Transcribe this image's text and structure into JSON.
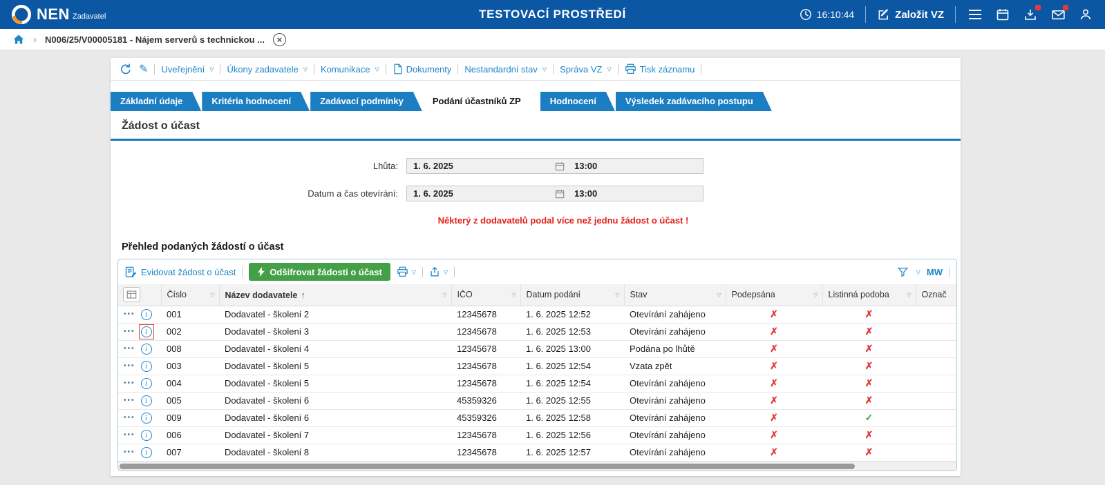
{
  "colors": {
    "topbar_bg": "#0b57a4",
    "tab_blue": "#1b7ec2",
    "link_blue": "#1d86c8",
    "green_button": "#43a047",
    "warning_red": "#e32119",
    "x_red": "#e53935",
    "check_green": "#43a047",
    "logo_orange": "#f7941d"
  },
  "topbar": {
    "brand": "NEN",
    "brand_sub": "Zadavatel",
    "env_title": "TESTOVACÍ PROSTŘEDÍ",
    "time": "16:10:44",
    "create_vz_label": "Založit VZ"
  },
  "breadcrumb": {
    "item": "N006/25/V00005181 - Nájem serverů s technickou ...",
    "separator": "›"
  },
  "toolbar": {
    "items": [
      {
        "label": "Uveřejnění",
        "caret": true
      },
      {
        "label": "Úkony zadavatele",
        "caret": true
      },
      {
        "label": "Komunikace",
        "caret": true
      },
      {
        "label": "Dokumenty",
        "icon": "document"
      },
      {
        "label": "Nestandardní stav",
        "caret": true
      },
      {
        "label": "Správa VZ",
        "caret": true
      },
      {
        "label": "Tisk záznamu",
        "icon": "printer"
      }
    ]
  },
  "tabs": [
    {
      "label": "Základní údaje",
      "active": false
    },
    {
      "label": "Kritéria hodnocení",
      "active": false
    },
    {
      "label": "Zadávací podmínky",
      "active": false
    },
    {
      "label": "Podání účastníků ZP",
      "active": true
    },
    {
      "label": "Hodnocení",
      "active": false
    },
    {
      "label": "Výsledek zadávacího postupu",
      "active": false
    }
  ],
  "content": {
    "section_title": "Žádost o účast",
    "fields": [
      {
        "label": "Lhůta:",
        "date": "1. 6. 2025",
        "time": "13:00"
      },
      {
        "label": "Datum a čas otevírání:",
        "date": "1. 6. 2025",
        "time": "13:00"
      }
    ],
    "warning": "Některý z dodavatelů podal více než jednu žádost o účast !",
    "grid_title": "Přehled podaných žádostí o účast"
  },
  "grid": {
    "toolbar": {
      "register_label": "Evidovat žádost o účast",
      "decrypt_label": "Odšifrovat žádosti o účast",
      "layout_label": "MW"
    },
    "columns": [
      "Číslo",
      "Název dodavatele",
      "IČO",
      "Datum podání",
      "Stav",
      "Podepsána",
      "Listinná podoba",
      "Označ"
    ],
    "sort": {
      "column": "Název dodavatele",
      "direction": "asc"
    },
    "rows": [
      {
        "cislo": "001",
        "nazev": "Dodavatel - školení 2",
        "ico": "12345678",
        "datum": "1. 6. 2025 12:52",
        "stav": "Otevírání zahájeno",
        "podepsana": false,
        "listinna": false,
        "focused": false
      },
      {
        "cislo": "002",
        "nazev": "Dodavatel - školení 3",
        "ico": "12345678",
        "datum": "1. 6. 2025 12:53",
        "stav": "Otevírání zahájeno",
        "podepsana": false,
        "listinna": false,
        "focused": true
      },
      {
        "cislo": "008",
        "nazev": "Dodavatel - školení 4",
        "ico": "12345678",
        "datum": "1. 6. 2025 13:00",
        "stav": "Podána po lhůtě",
        "podepsana": false,
        "listinna": false,
        "focused": false
      },
      {
        "cislo": "003",
        "nazev": "Dodavatel - školení 5",
        "ico": "12345678",
        "datum": "1. 6. 2025 12:54",
        "stav": "Vzata zpět",
        "podepsana": false,
        "listinna": false,
        "focused": false
      },
      {
        "cislo": "004",
        "nazev": "Dodavatel - školení 5",
        "ico": "12345678",
        "datum": "1. 6. 2025 12:54",
        "stav": "Otevírání zahájeno",
        "podepsana": false,
        "listinna": false,
        "focused": false
      },
      {
        "cislo": "005",
        "nazev": "Dodavatel - školení 6",
        "ico": "45359326",
        "datum": "1. 6. 2025 12:55",
        "stav": "Otevírání zahájeno",
        "podepsana": false,
        "listinna": false,
        "focused": false
      },
      {
        "cislo": "009",
        "nazev": "Dodavatel - školení 6",
        "ico": "45359326",
        "datum": "1. 6. 2025 12:58",
        "stav": "Otevírání zahájeno",
        "podepsana": false,
        "listinna": true,
        "focused": false
      },
      {
        "cislo": "006",
        "nazev": "Dodavatel - školení 7",
        "ico": "12345678",
        "datum": "1. 6. 2025 12:56",
        "stav": "Otevírání zahájeno",
        "podepsana": false,
        "listinna": false,
        "focused": false
      },
      {
        "cislo": "007",
        "nazev": "Dodavatel - školení 8",
        "ico": "12345678",
        "datum": "1. 6. 2025 12:57",
        "stav": "Otevírání zahájeno",
        "podepsana": false,
        "listinna": false,
        "focused": false
      }
    ]
  }
}
